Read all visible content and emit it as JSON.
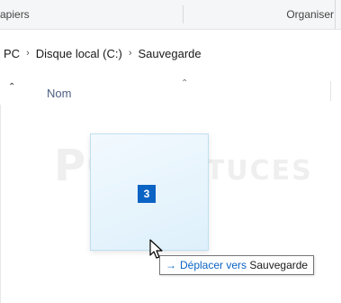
{
  "ribbon": {
    "clipboard_label": "apiers",
    "organize_label": "Organiser"
  },
  "address": {
    "crumbs": [
      "PC",
      "Disque local (C:)",
      "Sauvegarde"
    ]
  },
  "columns": {
    "name_header": "Nom"
  },
  "watermark": {
    "text_main": "PC",
    "text_rest": "ASTUCES"
  },
  "drag": {
    "count": "3"
  },
  "tooltip": {
    "verb": "Déplacer vers",
    "target": "Sauvegarde"
  },
  "icons": {
    "chevron": "chevron-right-icon",
    "sort": "sort-up-icon",
    "cursor": "arrow-cursor-icon",
    "move": "right-arrow-icon"
  },
  "colors": {
    "accent": "#0b63c4",
    "ghost_fill": "#def0fb",
    "column_header": "#4d6082"
  }
}
